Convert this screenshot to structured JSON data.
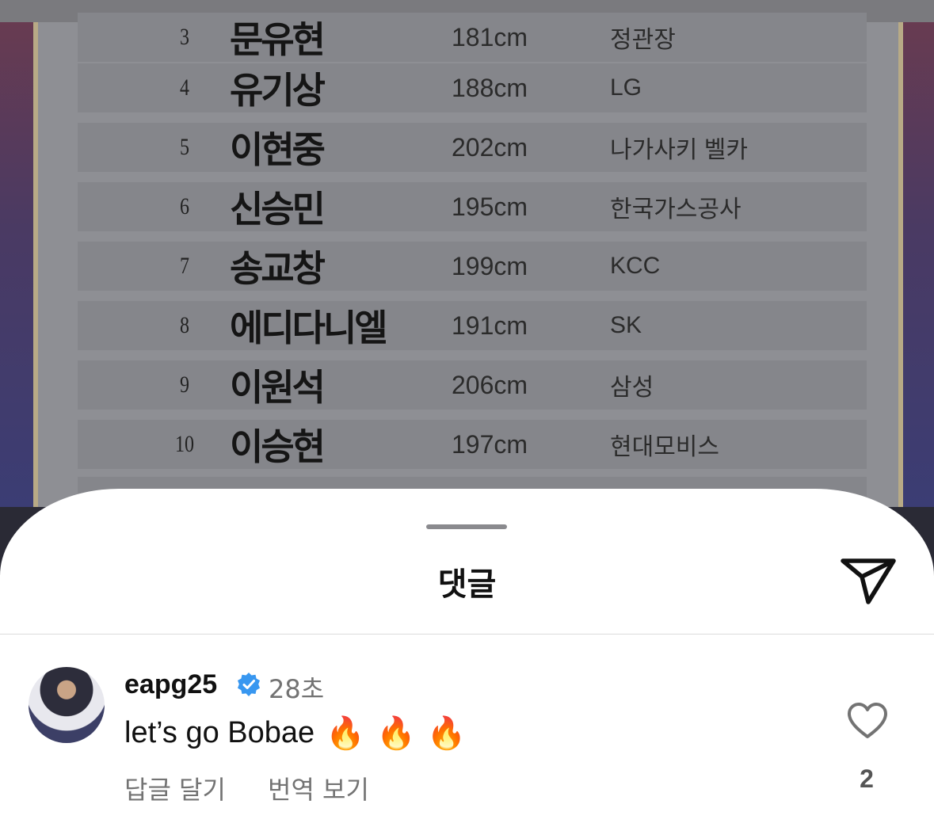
{
  "post": {
    "rows": [
      {
        "rank": "3",
        "name": "문유현",
        "height": "181cm",
        "team": "정관장"
      },
      {
        "rank": "4",
        "name": "유기상",
        "height": "188cm",
        "team": "LG"
      },
      {
        "rank": "5",
        "name": "이현중",
        "height": "202cm",
        "team": "나가사키 벨카"
      },
      {
        "rank": "6",
        "name": "신승민",
        "height": "195cm",
        "team": "한국가스공사"
      },
      {
        "rank": "7",
        "name": "송교창",
        "height": "199cm",
        "team": "KCC"
      },
      {
        "rank": "8",
        "name": "에디다니엘",
        "height": "191cm",
        "team": "SK"
      },
      {
        "rank": "9",
        "name": "이원석",
        "height": "206cm",
        "team": "삼성"
      },
      {
        "rank": "10",
        "name": "이승현",
        "height": "197cm",
        "team": "현대모비스"
      }
    ]
  },
  "sheet": {
    "title": "댓글",
    "share_icon": "send-icon"
  },
  "comment": {
    "username": "eapg25",
    "verified_icon": "verified-badge-icon",
    "time": "28초",
    "text": "let’s go Bobae",
    "emojis": [
      "🔥",
      "🔥",
      "🔥"
    ],
    "reply_label": "답글 달기",
    "translate_label": "번역 보기",
    "like_icon": "heart-icon",
    "like_count": "2"
  },
  "colors": {
    "verified_blue": "#3897f0",
    "secondary_text": "#737373"
  }
}
